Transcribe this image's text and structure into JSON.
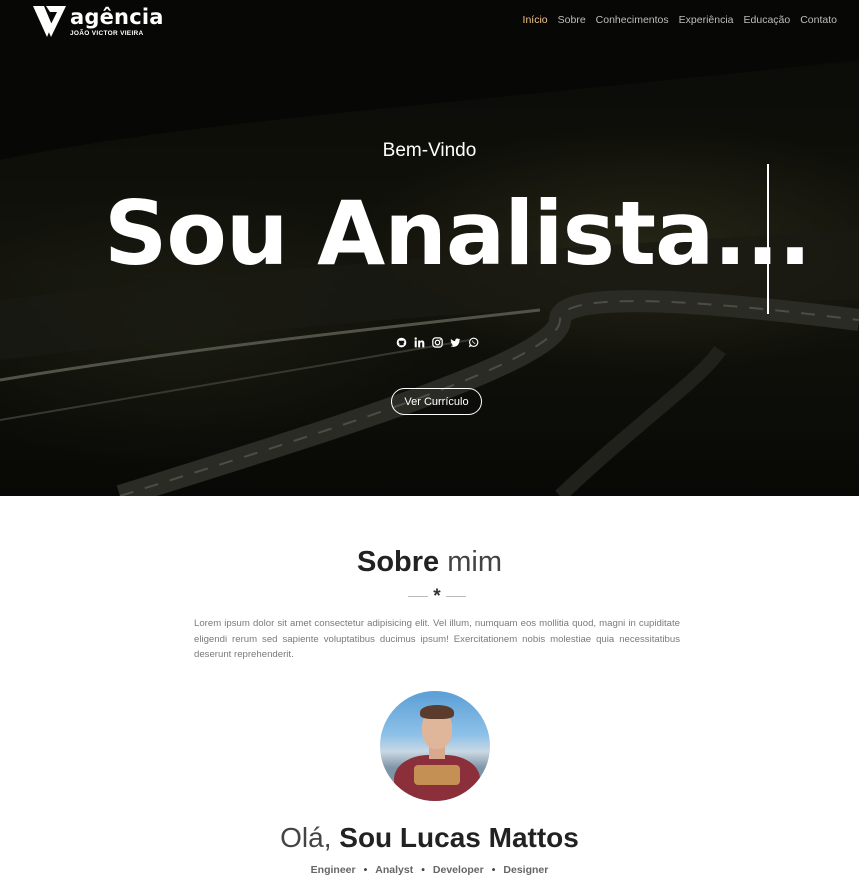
{
  "brand": {
    "name": "agência",
    "subtitle": "JOÃO VICTOR VIEIRA"
  },
  "nav": {
    "items": [
      "Início",
      "Sobre",
      "Conhecimentos",
      "Experiência",
      "Educação",
      "Contato"
    ],
    "active": "Início",
    "active_color": "#f3c58a"
  },
  "hero": {
    "welcome": "Bem-Vindo",
    "headline": "Sou Analista...",
    "socials": [
      "github-icon",
      "linkedin-icon",
      "instagram-icon",
      "twitter-icon",
      "whatsapp-icon"
    ],
    "cta_label": "Ver Currículo"
  },
  "about": {
    "title_strong": "Sobre",
    "title_light": "mim",
    "divider_glyph": "*",
    "text": "Lorem ipsum dolor sit amet consectetur adipisicing elit. Vel illum, numquam eos mollitia quod, magni in cupiditate eligendi rerum sed sapiente voluptatibus ducimus ipsum! Exercitationem nobis molestiae quia necessitatibus deserunt reprehenderit.",
    "greeting_light": "Olá,",
    "greeting_strong": "Sou Lucas Mattos",
    "roles": [
      "Engineer",
      "Analyst",
      "Developer",
      "Designer"
    ],
    "role_separator": "•"
  }
}
